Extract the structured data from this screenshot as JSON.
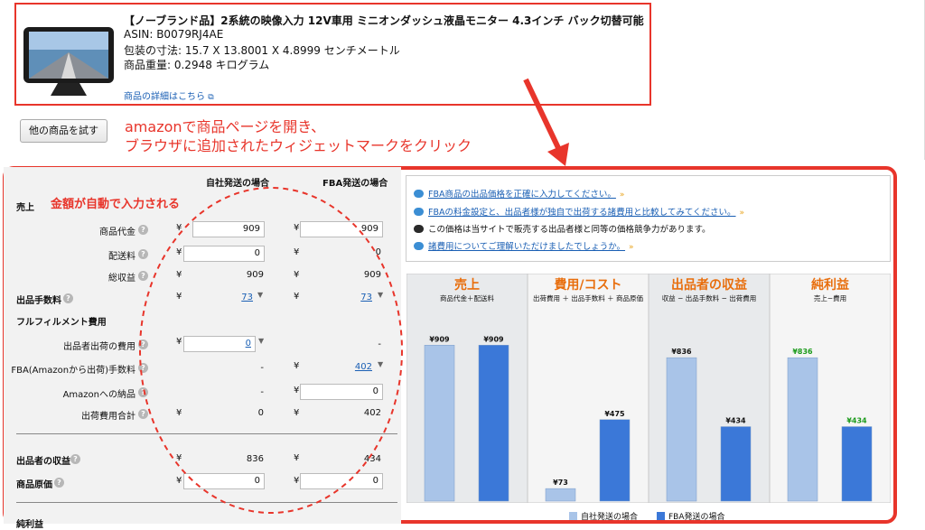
{
  "product": {
    "title": "【ノーブランド品】2系統の映像入力 12V車用 ミニオンダッシュ液晶モニター 4.3インチ バック切替可能",
    "asin": "ASIN: B0079RJ4AE",
    "dimensions": "包装の寸法: 15.7 X 13.8001 X 4.8999 センチメートル",
    "weight": "商品重量: 0.2948 キログラム",
    "detail_link": "商品の詳細はこちら"
  },
  "try_button": "他の商品を試す",
  "annotations": {
    "line1": "amazonで商品ページを開き、",
    "line2": "ブラウザに追加されたウィジェットマークをクリック",
    "auto": "金額が自動で入力される"
  },
  "calc": {
    "col_self": "自社発送の場合",
    "col_fba": "FBA発送の場合",
    "currency": "¥",
    "dash": "-",
    "sales_section": "売上",
    "item_price_label": "商品代金",
    "shipping_label": "配送料",
    "total_revenue_label": "総収益",
    "item_price_self": "909",
    "item_price_fba": "909",
    "shipping_self": "0",
    "shipping_fba": "0",
    "total_self": "909",
    "total_fba": "909",
    "fee_label": "出品手数料",
    "fee_self": "73",
    "fee_fba": "73",
    "fulfillment_section": "フルフィルメント費用",
    "seller_ship_label": "出品者出荷の費用",
    "seller_ship_self": "0",
    "fba_fee_label": "FBA(Amazonから出荷)手数料",
    "fba_fee_fba": "402",
    "inbound_label": "Amazonへの納品",
    "inbound_fba": "0",
    "ship_total_label": "出荷費用合計",
    "ship_total_self": "0",
    "ship_total_fba": "402",
    "proceeds_label": "出品者の収益",
    "proceeds_self": "836",
    "proceeds_fba": "434",
    "cost_label": "商品原価",
    "cost_self": "0",
    "cost_fba": "0",
    "net_label": "純利益"
  },
  "info": {
    "line1": "FBA商品の出品価格を正確に入力してください。",
    "line2": "FBAの料金設定と、出品者様が独自で出荷する諸費用と比較してみてください。",
    "line3": "この価格は当サイトで販売する出品者様と同等の価格競争力があります。",
    "line4": "諸費用についてご理解いただけましたでしょうか。"
  },
  "chart_data": {
    "type": "bar",
    "categories": [
      "売上",
      "費用/コスト",
      "出品者の収益",
      "純利益"
    ],
    "subtitles": [
      "商品代金＋配送料",
      "出荷費用 ＋ 出品手数料 ＋ 商品原価",
      "収益 − 出品手数料 − 出荷費用",
      "売上−費用"
    ],
    "series": [
      {
        "name": "自社発送の場合",
        "values": [
          909,
          73,
          836,
          836
        ],
        "labels": [
          "¥909",
          "¥73",
          "¥836",
          "¥836"
        ]
      },
      {
        "name": "FBA発送の場合",
        "values": [
          909,
          475,
          434,
          434
        ],
        "labels": [
          "¥909",
          "¥475",
          "¥434",
          "¥434"
        ]
      }
    ],
    "ylim": [
      0,
      1000
    ],
    "colors": {
      "self": "#a9c4e8",
      "fba": "#3b78d8",
      "profit_label": "#1a9a1a",
      "header": "#e86e0d"
    }
  }
}
